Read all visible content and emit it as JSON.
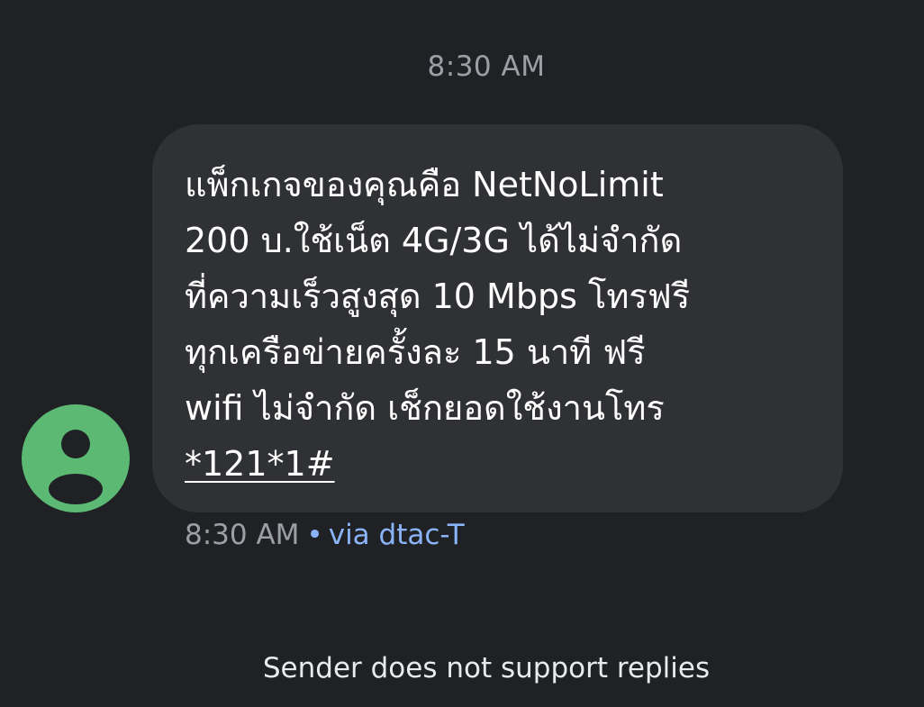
{
  "conversation": {
    "header_time": "8:30 AM"
  },
  "message": {
    "body": "แพ็กเกจของคุณคือ NetNoLimit\n200 บ.ใช้เน็ต 4G/3G ได้ไม่จำกัด\nที่ความเร็วสูงสุด 10 Mbps โทรฟรี\nทุกเครือข่ายครั้งละ 15 นาที ฟรี\nwifi ไม่จำกัด เช็กยอดใช้งานโทร\n",
    "ussd_code": "*121*1#",
    "time": "8:30 AM",
    "separator": "•",
    "via": "via dtac-T"
  },
  "footer": {
    "note": "Sender does not support replies"
  },
  "colors": {
    "background": "#202124",
    "bubble": "#303134",
    "avatar": "#5bb974",
    "link": "#8ab4f8",
    "muted_text": "#9aa0a6"
  },
  "icons": {
    "avatar": "person-icon"
  }
}
